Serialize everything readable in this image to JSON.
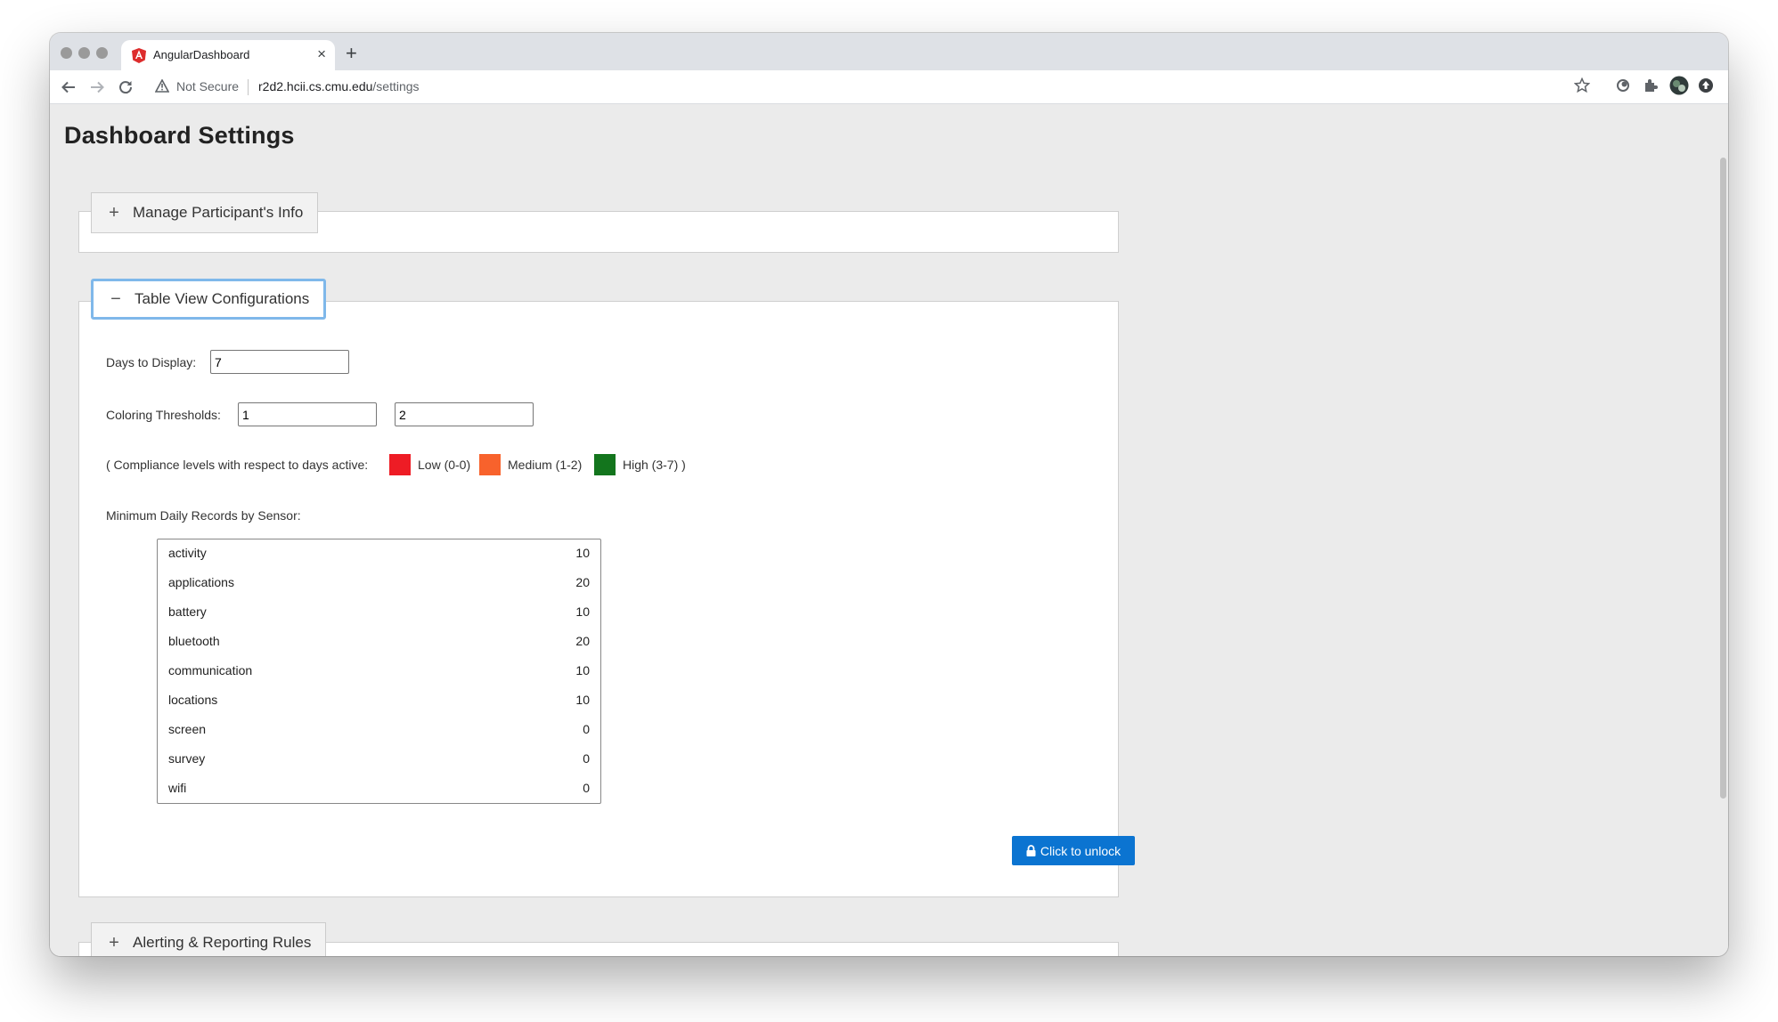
{
  "browser": {
    "tab_title": "AngularDashboard",
    "new_tab_symbol": "+",
    "security_label": "Not Secure",
    "url_host": "r2d2.hcii.cs.cmu.edu",
    "url_path": "/settings"
  },
  "page": {
    "title": "Dashboard Settings",
    "sections": {
      "participants": {
        "label": "Manage Participant's Info",
        "symbol": "+"
      },
      "table_view": {
        "label": "Table View Configurations",
        "symbol": "−"
      },
      "alerting": {
        "label": "Alerting & Reporting Rules",
        "symbol": "+"
      }
    }
  },
  "table_view": {
    "days_label": "Days to Display:",
    "days_value": "7",
    "thresholds_label": "Coloring Thresholds:",
    "threshold_low_value": "1",
    "threshold_high_value": "2",
    "compliance_prefix": "( Compliance levels with respect to days active:",
    "levels": [
      {
        "label": "Low (0-0)",
        "color": "#ee1c25"
      },
      {
        "label": "Medium (1-2)",
        "color": "#f8622c"
      },
      {
        "label": "High (3-7) )",
        "color": "#13751d"
      }
    ],
    "min_records_label": "Minimum Daily Records by Sensor:",
    "sensors": [
      {
        "name": "activity",
        "value": "10"
      },
      {
        "name": "applications",
        "value": "20"
      },
      {
        "name": "battery",
        "value": "10"
      },
      {
        "name": "bluetooth",
        "value": "20"
      },
      {
        "name": "communication",
        "value": "10"
      },
      {
        "name": "locations",
        "value": "10"
      },
      {
        "name": "screen",
        "value": "0"
      },
      {
        "name": "survey",
        "value": "0"
      },
      {
        "name": "wifi",
        "value": "0"
      }
    ],
    "unlock_label": "Click to unlock"
  },
  "colors": {
    "accent": "#0b74d1",
    "focus_ring": "#7fb8ea"
  }
}
